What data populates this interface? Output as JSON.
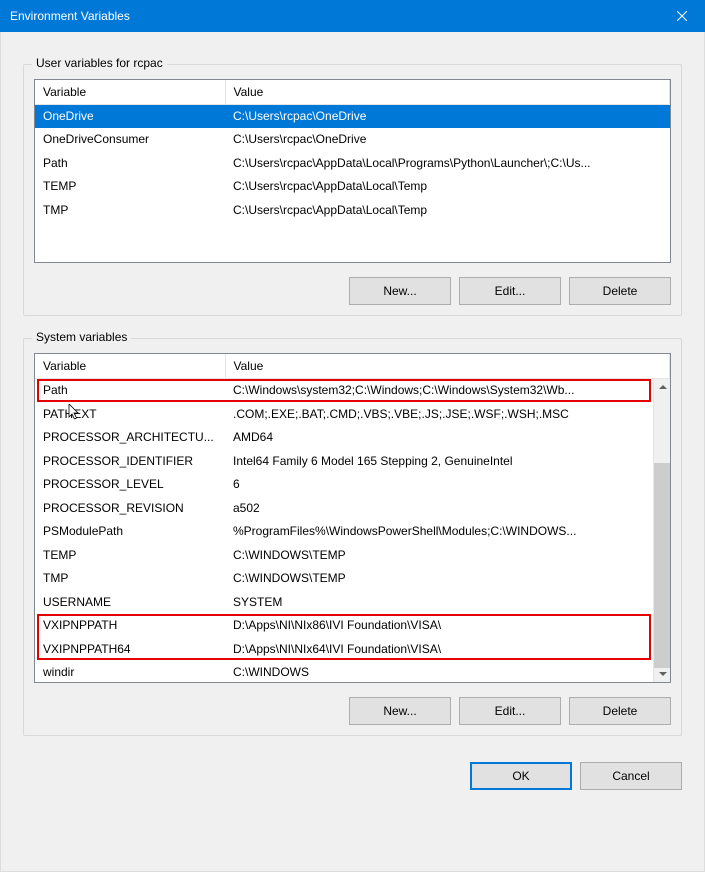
{
  "titlebar": {
    "title": "Environment Variables"
  },
  "user_group": {
    "label": "User variables for rcpac",
    "columns": [
      "Variable",
      "Value"
    ],
    "rows": [
      {
        "variable": "OneDrive",
        "value": "C:\\Users\\rcpac\\OneDrive",
        "selected": true
      },
      {
        "variable": "OneDriveConsumer",
        "value": "C:\\Users\\rcpac\\OneDrive"
      },
      {
        "variable": "Path",
        "value": "C:\\Users\\rcpac\\AppData\\Local\\Programs\\Python\\Launcher\\;C:\\Us..."
      },
      {
        "variable": "TEMP",
        "value": "C:\\Users\\rcpac\\AppData\\Local\\Temp"
      },
      {
        "variable": "TMP",
        "value": "C:\\Users\\rcpac\\AppData\\Local\\Temp"
      }
    ],
    "buttons": {
      "new": "New...",
      "edit": "Edit...",
      "delete": "Delete"
    }
  },
  "system_group": {
    "label": "System variables",
    "columns": [
      "Variable",
      "Value"
    ],
    "rows": [
      {
        "variable": "Path",
        "value": "C:\\Windows\\system32;C:\\Windows;C:\\Windows\\System32\\Wb..."
      },
      {
        "variable": "PATHEXT",
        "value": ".COM;.EXE;.BAT;.CMD;.VBS;.VBE;.JS;.JSE;.WSF;.WSH;.MSC"
      },
      {
        "variable": "PROCESSOR_ARCHITECTU...",
        "value": "AMD64"
      },
      {
        "variable": "PROCESSOR_IDENTIFIER",
        "value": "Intel64 Family 6 Model 165 Stepping 2, GenuineIntel"
      },
      {
        "variable": "PROCESSOR_LEVEL",
        "value": "6"
      },
      {
        "variable": "PROCESSOR_REVISION",
        "value": "a502"
      },
      {
        "variable": "PSModulePath",
        "value": "%ProgramFiles%\\WindowsPowerShell\\Modules;C:\\WINDOWS..."
      },
      {
        "variable": "TEMP",
        "value": "C:\\WINDOWS\\TEMP"
      },
      {
        "variable": "TMP",
        "value": "C:\\WINDOWS\\TEMP"
      },
      {
        "variable": "USERNAME",
        "value": "SYSTEM"
      },
      {
        "variable": "VXIPNPPATH",
        "value": "D:\\Apps\\NI\\NIx86\\IVI Foundation\\VISA\\"
      },
      {
        "variable": "VXIPNPPATH64",
        "value": "D:\\Apps\\NI\\NIx64\\IVI Foundation\\VISA\\"
      },
      {
        "variable": "windir",
        "value": "C:\\WINDOWS"
      }
    ],
    "buttons": {
      "new": "New...",
      "edit": "Edit...",
      "delete": "Delete"
    }
  },
  "footer": {
    "ok": "OK",
    "cancel": "Cancel"
  }
}
